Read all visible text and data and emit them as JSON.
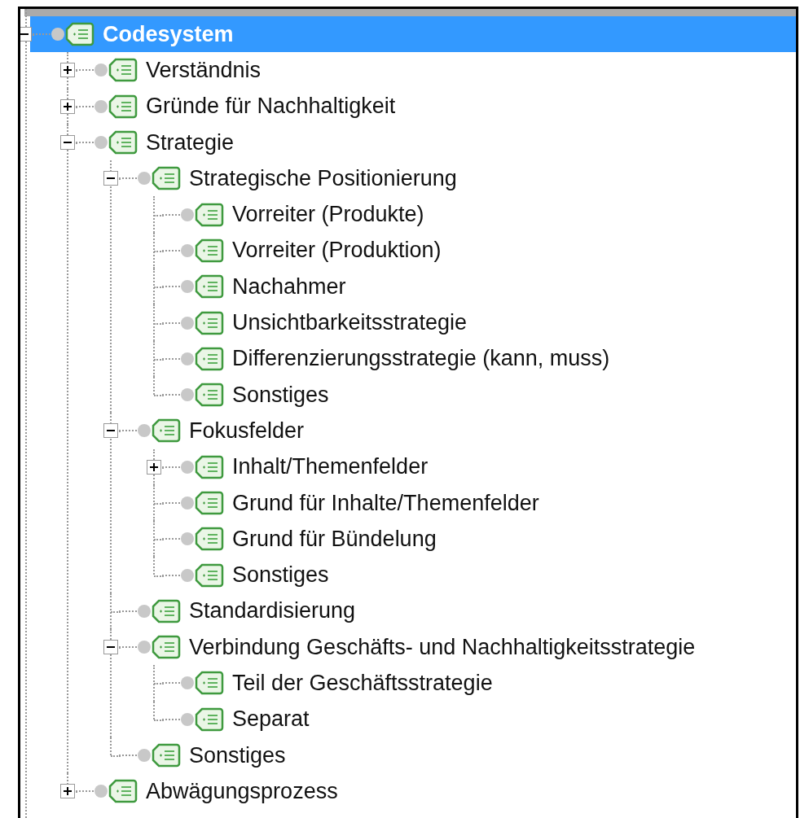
{
  "tree": [
    {
      "label": "Codesystem",
      "selected": true,
      "expanded": true,
      "children": [
        {
          "label": "Verständnis",
          "selected": false,
          "expanded": false
        },
        {
          "label": "Gründe für Nachhaltigkeit",
          "selected": false,
          "expanded": false
        },
        {
          "label": "Strategie",
          "selected": false,
          "expanded": true,
          "children": [
            {
              "label": "Strategische Positionierung",
              "selected": false,
              "expanded": true,
              "children": [
                {
                  "label": "Vorreiter (Produkte)",
                  "selected": false
                },
                {
                  "label": "Vorreiter (Produktion)",
                  "selected": false
                },
                {
                  "label": "Nachahmer",
                  "selected": false
                },
                {
                  "label": "Unsichtbarkeitsstrategie",
                  "selected": false
                },
                {
                  "label": "Differenzierungsstrategie (kann, muss)",
                  "selected": false
                },
                {
                  "label": "Sonstiges",
                  "selected": false
                }
              ]
            },
            {
              "label": "Fokusfelder",
              "selected": false,
              "expanded": true,
              "children": [
                {
                  "label": "Inhalt/Themenfelder",
                  "selected": false,
                  "expanded": false
                },
                {
                  "label": "Grund für Inhalte/Themenfelder",
                  "selected": false
                },
                {
                  "label": "Grund für Bündelung",
                  "selected": false
                },
                {
                  "label": "Sonstiges",
                  "selected": false
                }
              ]
            },
            {
              "label": "Standardisierung",
              "selected": false
            },
            {
              "label": "Verbindung Geschäfts- und Nachhaltigkeitsstrategie",
              "selected": false,
              "expanded": true,
              "children": [
                {
                  "label": "Teil der Geschäftsstrategie",
                  "selected": false
                },
                {
                  "label": "Separat",
                  "selected": false
                }
              ]
            },
            {
              "label": "Sonstiges",
              "selected": false
            }
          ]
        },
        {
          "label": "Abwägungsprozess",
          "selected": false,
          "expanded": false
        }
      ]
    }
  ]
}
